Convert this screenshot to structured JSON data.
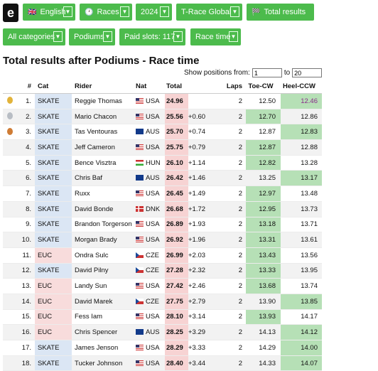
{
  "nav": {
    "language": "English",
    "races": "Races",
    "year": "2024",
    "series": "T-Race Global",
    "view": "Total results",
    "category": "All categories",
    "stage": "Podiums",
    "paid_slots": "Paid slots: 117",
    "mode": "Race time"
  },
  "title": "Total results after Podiums - Race time",
  "positions": {
    "label": "Show positions from:",
    "from": "1",
    "to_label": "to",
    "to": "20"
  },
  "columns": {
    "rank": "#",
    "cat": "Cat",
    "rider": "Rider",
    "nat": "Nat",
    "total": "Total",
    "laps": "Laps",
    "toe": "Toe-CW",
    "heel": "Heel-CCW"
  },
  "rows": [
    {
      "medal": "gold",
      "rank": "1.",
      "cat": "SKATE",
      "rider": "Reggie Thomas",
      "nat": "USA",
      "total": "24.96",
      "diff": "",
      "laps": "2",
      "toe": "12.50",
      "heel": "12.46",
      "best": "heel",
      "heel_hl": true
    },
    {
      "medal": "silver",
      "rank": "2.",
      "cat": "SKATE",
      "rider": "Mario Chacon",
      "nat": "USA",
      "total": "25.56",
      "diff": "+0.60",
      "laps": "2",
      "toe": "12.70",
      "heel": "12.86",
      "best": "toe"
    },
    {
      "medal": "bronze",
      "rank": "3.",
      "cat": "SKATE",
      "rider": "Tas Ventouras",
      "nat": "AUS",
      "total": "25.70",
      "diff": "+0.74",
      "laps": "2",
      "toe": "12.87",
      "heel": "12.83",
      "best": "heel"
    },
    {
      "medal": "",
      "rank": "4.",
      "cat": "SKATE",
      "rider": "Jeff Cameron",
      "nat": "USA",
      "total": "25.75",
      "diff": "+0.79",
      "laps": "2",
      "toe": "12.87",
      "heel": "12.88",
      "best": "toe"
    },
    {
      "medal": "",
      "rank": "5.",
      "cat": "SKATE",
      "rider": "Bence Visztra",
      "nat": "HUN",
      "total": "26.10",
      "diff": "+1.14",
      "laps": "2",
      "toe": "12.82",
      "heel": "13.28",
      "best": "toe"
    },
    {
      "medal": "",
      "rank": "6.",
      "cat": "SKATE",
      "rider": "Chris Baf",
      "nat": "AUS",
      "total": "26.42",
      "diff": "+1.46",
      "laps": "2",
      "toe": "13.25",
      "heel": "13.17",
      "best": "heel"
    },
    {
      "medal": "",
      "rank": "7.",
      "cat": "SKATE",
      "rider": "Ruxx",
      "nat": "USA",
      "total": "26.45",
      "diff": "+1.49",
      "laps": "2",
      "toe": "12.97",
      "heel": "13.48",
      "best": "toe"
    },
    {
      "medal": "",
      "rank": "8.",
      "cat": "SKATE",
      "rider": "David Bonde",
      "nat": "DNK",
      "total": "26.68",
      "diff": "+1.72",
      "laps": "2",
      "toe": "12.95",
      "heel": "13.73",
      "best": "toe"
    },
    {
      "medal": "",
      "rank": "9.",
      "cat": "SKATE",
      "rider": "Brandon Torgerson",
      "nat": "USA",
      "total": "26.89",
      "diff": "+1.93",
      "laps": "2",
      "toe": "13.18",
      "heel": "13.71",
      "best": "toe"
    },
    {
      "medal": "",
      "rank": "10.",
      "cat": "SKATE",
      "rider": "Morgan Brady",
      "nat": "USA",
      "total": "26.92",
      "diff": "+1.96",
      "laps": "2",
      "toe": "13.31",
      "heel": "13.61",
      "best": "toe"
    },
    {
      "medal": "",
      "rank": "11.",
      "cat": "EUC",
      "rider": "Ondra Sulc",
      "nat": "CZE",
      "total": "26.99",
      "diff": "+2.03",
      "laps": "2",
      "toe": "13.43",
      "heel": "13.56",
      "best": "toe"
    },
    {
      "medal": "",
      "rank": "12.",
      "cat": "SKATE",
      "rider": "David Pilny",
      "nat": "CZE",
      "total": "27.28",
      "diff": "+2.32",
      "laps": "2",
      "toe": "13.33",
      "heel": "13.95",
      "best": "toe"
    },
    {
      "medal": "",
      "rank": "13.",
      "cat": "EUC",
      "rider": "Landy Sun",
      "nat": "USA",
      "total": "27.42",
      "diff": "+2.46",
      "laps": "2",
      "toe": "13.68",
      "heel": "13.74",
      "best": "toe"
    },
    {
      "medal": "",
      "rank": "14.",
      "cat": "EUC",
      "rider": "David Marek",
      "nat": "CZE",
      "total": "27.75",
      "diff": "+2.79",
      "laps": "2",
      "toe": "13.90",
      "heel": "13.85",
      "best": "heel"
    },
    {
      "medal": "",
      "rank": "15.",
      "cat": "EUC",
      "rider": "Fess Iam",
      "nat": "USA",
      "total": "28.10",
      "diff": "+3.14",
      "laps": "2",
      "toe": "13.93",
      "heel": "14.17",
      "best": "toe"
    },
    {
      "medal": "",
      "rank": "16.",
      "cat": "EUC",
      "rider": "Chris Spencer",
      "nat": "AUS",
      "total": "28.25",
      "diff": "+3.29",
      "laps": "2",
      "toe": "14.13",
      "heel": "14.12",
      "best": "heel"
    },
    {
      "medal": "",
      "rank": "17.",
      "cat": "SKATE",
      "rider": "James Jenson",
      "nat": "USA",
      "total": "28.29",
      "diff": "+3.33",
      "laps": "2",
      "toe": "14.29",
      "heel": "14.00",
      "best": "heel"
    },
    {
      "medal": "",
      "rank": "18.",
      "cat": "SKATE",
      "rider": "Tucker Johnson",
      "nat": "USA",
      "total": "28.40",
      "diff": "+3.44",
      "laps": "2",
      "toe": "14.33",
      "heel": "14.07",
      "best": "heel"
    }
  ]
}
